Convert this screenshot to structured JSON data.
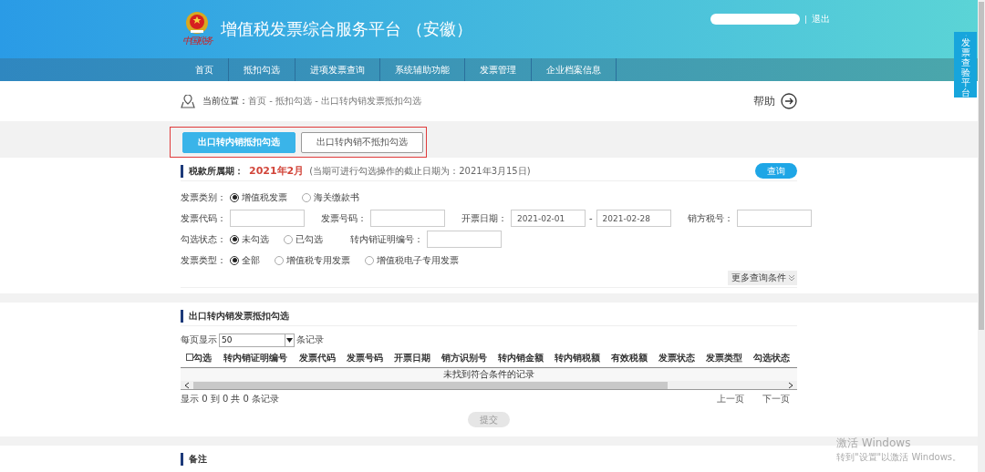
{
  "header": {
    "title": "增值税发票综合服务平台 （安徽）",
    "logo_text": "中国税务",
    "logout": "退出"
  },
  "nav": [
    "首页",
    "抵扣勾选",
    "进项发票查询",
    "系统辅助功能",
    "发票管理",
    "企业档案信息"
  ],
  "breadcrumb": {
    "label": "当前位置：",
    "path": "首页 - 抵扣勾选 - 出口转内销发票抵扣勾选"
  },
  "help": "帮助",
  "tabs": [
    {
      "label": "出口转内销抵扣勾选",
      "selected": true
    },
    {
      "label": "出口转内销不抵扣勾选",
      "selected": false
    }
  ],
  "period": {
    "label": "税款所属期：",
    "value": "2021年2月",
    "note": "(当期可进行勾选操作的截止日期为：2021年3月15日)"
  },
  "query_button": "查询",
  "form_rows": [
    [
      {
        "kind": "radio",
        "label": "发票类别：",
        "options": [
          {
            "label": "增值税发票",
            "selected": true
          },
          {
            "label": "海关缴款书",
            "selected": false
          }
        ]
      }
    ],
    [
      {
        "kind": "text",
        "label": "发票代码："
      },
      {
        "kind": "text",
        "label": "发票号码："
      },
      {
        "kind": "range",
        "label": "开票日期：",
        "from": "2021-02-01",
        "sep": "-",
        "to": "2021-02-28"
      },
      {
        "kind": "text",
        "label": "销方税号："
      }
    ],
    [
      {
        "kind": "radio",
        "label": "勾选状态：",
        "options": [
          {
            "label": "未勾选",
            "selected": true
          },
          {
            "label": "已勾选",
            "selected": false
          }
        ]
      },
      {
        "kind": "text",
        "label": "转内销证明编号："
      }
    ],
    [
      {
        "kind": "radio",
        "label": "发票类型：",
        "options": [
          {
            "label": "全部",
            "selected": true
          },
          {
            "label": "增值税专用发票",
            "selected": false
          },
          {
            "label": "增值税电子专用发票",
            "selected": false
          }
        ]
      }
    ]
  ],
  "more_conditions": "更多查询条件",
  "table_section": {
    "title": "出口转内销发票抵扣勾选",
    "page_size_label": "每页显示",
    "page_size": "50",
    "records_label": "条记录",
    "select_all": {
      "label": "勾选",
      "checked": false
    },
    "columns": [
      "转内销证明编号",
      "发票代码",
      "发票号码",
      "开票日期",
      "销方识别号",
      "转内销金额",
      "转内销税额",
      "有效税额",
      "发票状态",
      "发票类型",
      "勾选状态"
    ],
    "empty_message": "未找到符合条件的记录",
    "summary": "显示 0 到 0 共 0 条记录",
    "prev": "上一页",
    "next": "下一页",
    "submit": {
      "label": "提交",
      "disabled": true
    }
  },
  "notes_title": "备注",
  "side_tab": "发票查验平台",
  "os_watermark": {
    "title": "激活 Windows",
    "hint": "转到\"设置\"以激活 Windows。"
  }
}
